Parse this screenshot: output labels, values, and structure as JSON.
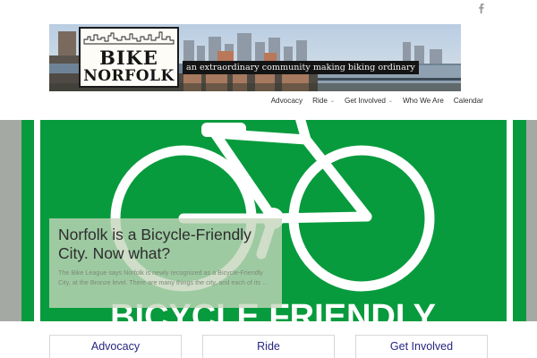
{
  "header": {
    "social_icon": "facebook-icon",
    "logo_line1": "BIKE",
    "logo_line2": "NORFOLK",
    "tagline": "an extraordinary community making biking ordinary"
  },
  "nav": {
    "items": [
      {
        "label": "Advocacy",
        "dropdown": false
      },
      {
        "label": "Ride",
        "dropdown": true
      },
      {
        "label": "Get Involved",
        "dropdown": true
      },
      {
        "label": "Who We Are",
        "dropdown": false
      },
      {
        "label": "Calendar",
        "dropdown": false
      }
    ],
    "dropdown_glyph": "⌄"
  },
  "hero": {
    "sign_text": "BICYCLE FRIENDLY",
    "caption_title": "Norfolk is a Bicycle-Friendly City. Now what?",
    "caption_text": "The Bike League says Norfolk is newly recognized as a Bicycle-Friendly City, at the Bronze level. There are many things the city, and each of its ..."
  },
  "cards": [
    {
      "label": "Advocacy"
    },
    {
      "label": "Ride"
    },
    {
      "label": "Get Involved"
    }
  ],
  "colors": {
    "sign_green": "#079b3d",
    "nav_text": "#2d2d2d",
    "card_text": "#262680",
    "caption_bg": "#c4d6bb"
  }
}
